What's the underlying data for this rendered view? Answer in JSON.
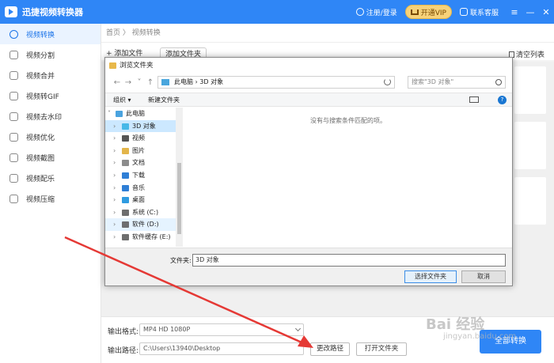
{
  "app": {
    "title": "迅捷视频转换器",
    "login": "注册/登录",
    "vip": "开通VIP",
    "service": "联系客服",
    "win_menu": "≡",
    "win_min": "—",
    "win_close": "✕"
  },
  "sidebar": {
    "items": [
      {
        "label": "视频转换",
        "icon": "convert-icon"
      },
      {
        "label": "视频分割",
        "icon": "split-icon"
      },
      {
        "label": "视频合并",
        "icon": "merge-icon"
      },
      {
        "label": "视频转GIF",
        "icon": "gif-icon"
      },
      {
        "label": "视频去水印",
        "icon": "watermark-icon"
      },
      {
        "label": "视频优化",
        "icon": "optimize-icon"
      },
      {
        "label": "视频截图",
        "icon": "screenshot-icon"
      },
      {
        "label": "视频配乐",
        "icon": "music-icon"
      },
      {
        "label": "视频压缩",
        "icon": "compress-icon"
      }
    ]
  },
  "main": {
    "breadcrumb": "首页 〉 视频转换",
    "add_file": "+ 添加文件",
    "add_folder": "添加文件夹",
    "clear_list": "清空列表",
    "format_label": "输出格式:",
    "format_value": "MP4  HD 1080P",
    "path_label": "输出路径:",
    "path_value": "C:\\Users\\13940\\Desktop",
    "change_path": "更改路径",
    "open_folder": "打开文件夹",
    "convert_all": "全部转换"
  },
  "dialog": {
    "title": "浏览文件夹",
    "address": "此电脑  ›  3D 对象",
    "search_placeholder": "搜索\"3D 对象\"",
    "organize": "组织 ▾",
    "new_folder": "新建文件夹",
    "help": "?",
    "empty_message": "没有与搜索条件匹配的项。",
    "tree": [
      {
        "label": "此电脑",
        "icon": "pc-icon",
        "color": "#4aa3df"
      },
      {
        "label": "3D 对象",
        "icon": "3d-icon",
        "color": "#48b8e8"
      },
      {
        "label": "视频",
        "icon": "video-icon",
        "color": "#555555"
      },
      {
        "label": "图片",
        "icon": "picture-icon",
        "color": "#e3b54a"
      },
      {
        "label": "文档",
        "icon": "document-icon",
        "color": "#8c8c8c"
      },
      {
        "label": "下载",
        "icon": "download-icon",
        "color": "#2f7fd6"
      },
      {
        "label": "音乐",
        "icon": "music-icon",
        "color": "#2f7fd6"
      },
      {
        "label": "桌面",
        "icon": "desktop-icon",
        "color": "#2f9be0"
      },
      {
        "label": "系统 (C:)",
        "icon": "drive-icon",
        "color": "#6e6e6e"
      },
      {
        "label": "软件 (D:)",
        "icon": "drive-icon",
        "color": "#6e6e6e"
      },
      {
        "label": "软件缓存 (E:)",
        "icon": "drive-icon",
        "color": "#6e6e6e"
      }
    ],
    "folder_label": "文件夹:",
    "folder_value": "3D 对象",
    "select_button": "选择文件夹",
    "cancel_button": "取消"
  },
  "watermark": {
    "text": "Bai 经验",
    "sub": "jingyan.baidu.com"
  },
  "colors": {
    "accent": "#2f86f6",
    "arrow": "#e53935"
  }
}
